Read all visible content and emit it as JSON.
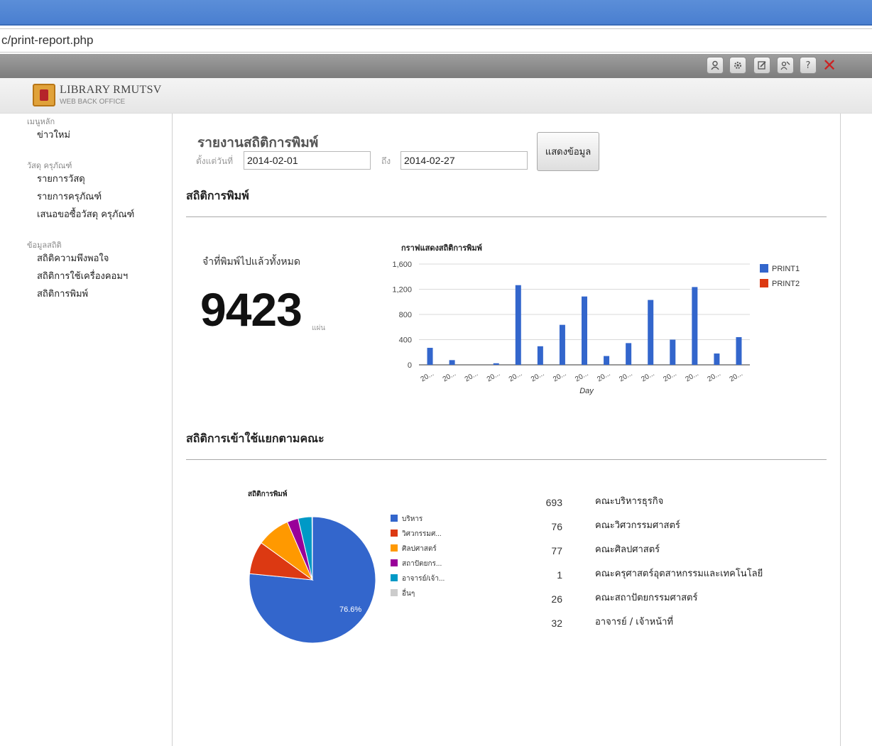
{
  "browser": {
    "url": "c/print-report.php"
  },
  "toolbar": {
    "icons": [
      "user-icon",
      "settings-icon",
      "edit-icon",
      "users-icon",
      "help-icon",
      "close-icon"
    ],
    "help_glyph": "?",
    "close_glyph": "✕"
  },
  "logo": {
    "title": "LIBRARY RMUTSV",
    "subtitle": "WEB BACK OFFICE"
  },
  "sidebar": {
    "groups": [
      {
        "heading": "เมนูหลัก",
        "items": [
          "ข่าวใหม่"
        ]
      },
      {
        "heading": "วัสดุ ครุภัณฑ์",
        "items": [
          "รายการวัสดุ",
          "รายการครุภัณฑ์",
          "เสนอขอซื้อวัสดุ ครุภัณฑ์"
        ]
      },
      {
        "heading": "ข้อมูลสถิติ",
        "items": [
          "สถิติความพึงพอใจ",
          "สถิติการใช้เครื่องคอมฯ",
          "สถิติการพิมพ์"
        ]
      }
    ]
  },
  "report": {
    "title": "รายงานสถิติการพิมพ์",
    "from_label": "ตั้งแต่วันที่",
    "from_value": "2014-02-01",
    "to_label": "ถึง",
    "to_value": "2014-02-27",
    "show_button": "แสดงข้อมูล"
  },
  "section_print": {
    "title": "สถิติการพิมพ์",
    "total_label": "จำที่พิมพ์ไปแล้วทั้งหมด",
    "total_value": "9423",
    "total_unit": "แผ่น"
  },
  "section_faculty": {
    "title": "สถิติการเข้าใช้แยกตามคณะ"
  },
  "faculty_stats": [
    {
      "count": "693",
      "name": "คณะบริหารธุรกิจ"
    },
    {
      "count": "76",
      "name": "คณะวิศวกรรมศาสตร์"
    },
    {
      "count": "77",
      "name": "คณะศิลปศาสตร์"
    },
    {
      "count": "1",
      "name": "คณะครุศาสตร์อุตสาหกรรมและเทคโนโลยี"
    },
    {
      "count": "26",
      "name": "คณะสถาปัตยกรรมศาสตร์"
    },
    {
      "count": "32",
      "name": "อาจารย์ / เจ้าหน้าที่"
    }
  ],
  "chart_data": [
    {
      "type": "bar",
      "title": "กราฟแสดงสถิติการพิมพ์",
      "xlabel": "Day",
      "ylabel": "",
      "categories": [
        "20...",
        "20...",
        "20...",
        "20...",
        "20...",
        "20...",
        "20...",
        "20...",
        "20...",
        "20...",
        "20...",
        "20...",
        "20...",
        "20...",
        "20..."
      ],
      "series": [
        {
          "name": "PRINT1",
          "color": "#3366cc",
          "values": [
            270,
            75,
            0,
            25,
            1265,
            295,
            635,
            1085,
            140,
            345,
            1030,
            400,
            1235,
            180,
            440
          ]
        },
        {
          "name": "PRINT2",
          "color": "#dc3912",
          "values": [
            0,
            0,
            0,
            0,
            0,
            0,
            0,
            0,
            0,
            0,
            0,
            0,
            0,
            0,
            0
          ]
        }
      ],
      "ylim": [
        0,
        1600
      ],
      "yticks": [
        "0",
        "400",
        "800",
        "1,200",
        "1,600"
      ],
      "grid": true,
      "legend": "right"
    },
    {
      "type": "pie",
      "title": "สถิติการพิมพ์",
      "labels": [
        "บริหาร",
        "วิศวกรรมศ...",
        "ศิลปศาสตร์",
        "สถาปัตยกร...",
        "อาจารย์/เจ้า...",
        "อื่นๆ"
      ],
      "values": [
        693,
        76,
        77,
        26,
        32,
        1
      ],
      "colors": [
        "#3366cc",
        "#dc3912",
        "#ff9900",
        "#990099",
        "#0099c6",
        "#cccccc"
      ],
      "slice_label": "76.6%",
      "legend": "right"
    }
  ]
}
